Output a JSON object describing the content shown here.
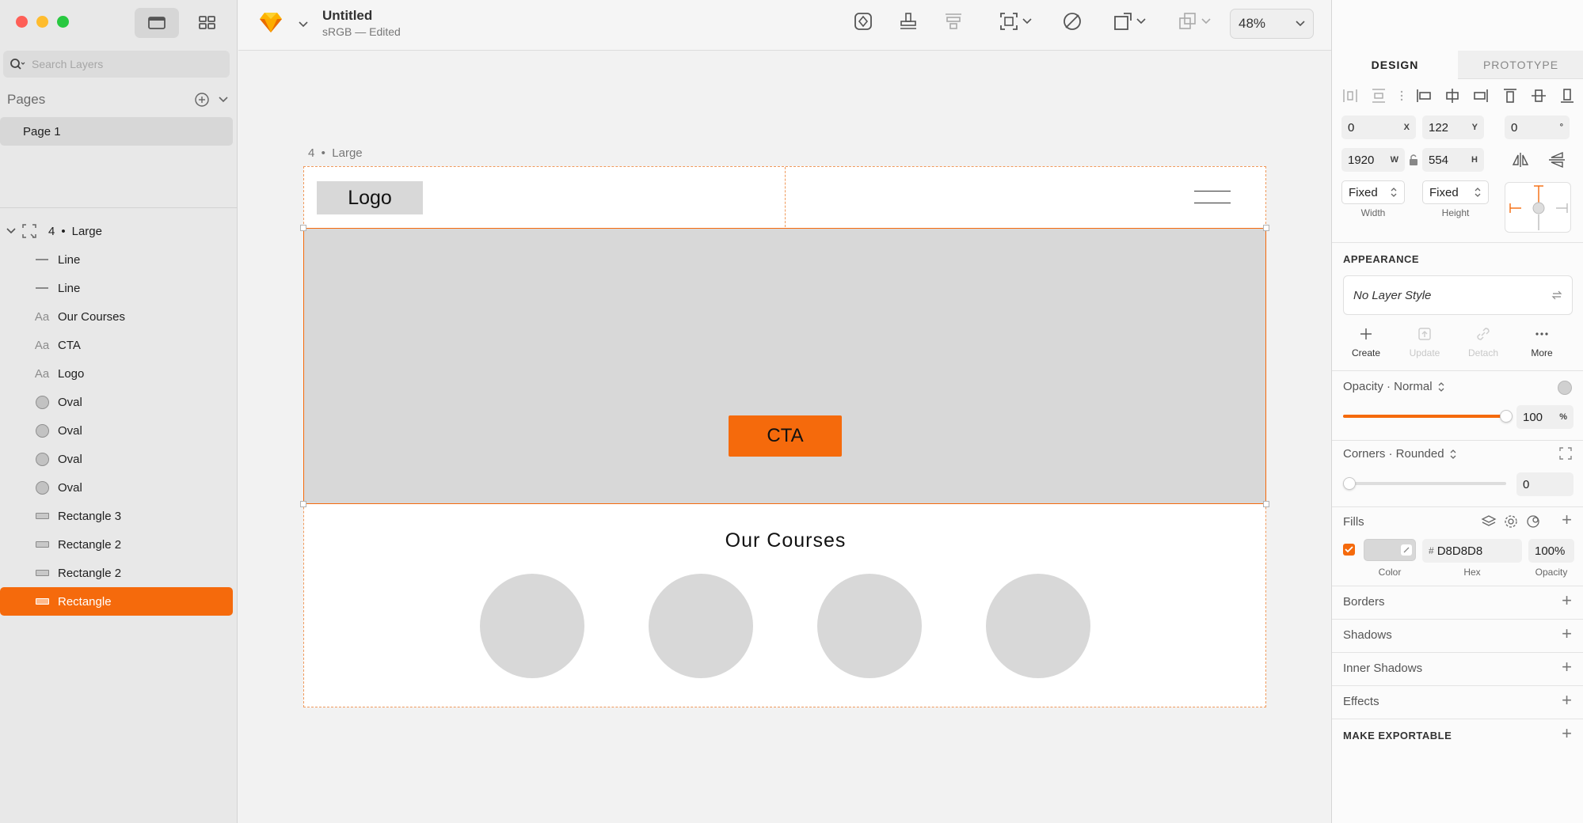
{
  "sidebar": {
    "search_placeholder": "Search Layers",
    "pages_title": "Pages",
    "pages": [
      {
        "label": "Page 1"
      }
    ],
    "group": {
      "num": "4",
      "sep": "•",
      "name": "Large"
    },
    "layers": [
      {
        "icon": "line-icon",
        "label": "Line"
      },
      {
        "icon": "line-icon",
        "label": "Line"
      },
      {
        "icon": "text-layer-icon",
        "label": "Our Courses"
      },
      {
        "icon": "text-layer-icon",
        "label": "CTA"
      },
      {
        "icon": "text-layer-icon",
        "label": "Logo"
      },
      {
        "icon": "oval-icon",
        "label": "Oval"
      },
      {
        "icon": "oval-icon",
        "label": "Oval"
      },
      {
        "icon": "oval-icon",
        "label": "Oval"
      },
      {
        "icon": "oval-icon",
        "label": "Oval"
      },
      {
        "icon": "rectangle-icon",
        "label": "Rectangle 3"
      },
      {
        "icon": "rectangle-icon",
        "label": "Rectangle 2"
      },
      {
        "icon": "rectangle-icon",
        "label": "Rectangle 2"
      },
      {
        "icon": "rectangle-icon",
        "label": "Rectangle",
        "selected": true
      }
    ],
    "text_icon_glyph": "Aa"
  },
  "toolbar": {
    "doc_title": "Untitled",
    "doc_subtitle": "sRGB — Edited",
    "zoom": "48%"
  },
  "canvas": {
    "artboard_label": "4  •  Large",
    "logo_text": "Logo",
    "cta_text": "CTA",
    "section_title": "Our Courses"
  },
  "inspector": {
    "tabs": [
      "DESIGN",
      "PROTOTYPE"
    ],
    "x": "0",
    "x_unit": "X",
    "y": "122",
    "y_unit": "Y",
    "rotation": "0",
    "rotation_unit": "°",
    "w": "1920",
    "w_unit": "W",
    "h": "554",
    "h_unit": "H",
    "width_mode": "Fixed",
    "width_caption": "Width",
    "height_mode": "Fixed",
    "height_caption": "Height",
    "appearance_title": "APPEARANCE",
    "layer_style": "No Layer Style",
    "style_actions": [
      "Create",
      "Update",
      "Detach",
      "More"
    ],
    "opacity_label": "Opacity · Normal",
    "opacity_value": "100",
    "opacity_unit": "%",
    "opacity_fraction": 1.0,
    "corners_label": "Corners · Rounded",
    "corners_value": "0",
    "fills_title": "Fills",
    "fill_hex_prefix": "#",
    "fill_hex": "D8D8D8",
    "fill_opacity": "100%",
    "fill_captions": [
      "Color",
      "Hex",
      "Opacity"
    ],
    "sections": [
      "Borders",
      "Shadows",
      "Inner Shadows",
      "Effects"
    ],
    "export_title": "MAKE EXPORTABLE"
  },
  "colors": {
    "accent": "#f56a0c",
    "fill": "#D8D8D8"
  }
}
